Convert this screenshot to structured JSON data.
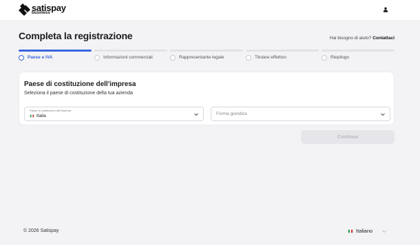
{
  "brand": {
    "name": "satispay",
    "sub": "business",
    "logo_color": "#111111"
  },
  "header": {
    "user_icon": "user-icon"
  },
  "page": {
    "title": "Completa la registrazione",
    "help_text": "Hai bisogno di aiuto?",
    "help_link": "Contattaci"
  },
  "stepper": {
    "accent_color": "#3a66dd",
    "active_index": 0,
    "steps": [
      {
        "label": "Paese e IVA",
        "state": "active"
      },
      {
        "label": "Informazioni commerciali",
        "state": "pending"
      },
      {
        "label": "Rappresentante legale",
        "state": "pending"
      },
      {
        "label": "Titolare effettivo",
        "state": "pending"
      },
      {
        "label": "Riepilogo",
        "state": "pending"
      }
    ]
  },
  "card": {
    "title": "Paese di costituzione dell'impresa",
    "subtitle": "Seleziona il paese di costituzione della tua azienda",
    "country_field": {
      "label": "Paese di costituzione dell'impresa",
      "value": "Italia",
      "flag": "italy-flag"
    },
    "legal_form_field": {
      "placeholder": "Forma giuridica"
    }
  },
  "actions": {
    "continue_label": "Continua",
    "continue_disabled": true
  },
  "footer": {
    "copyright": "© 2026 Satispay",
    "language": "Italiano",
    "language_flag": "italy-flag"
  }
}
